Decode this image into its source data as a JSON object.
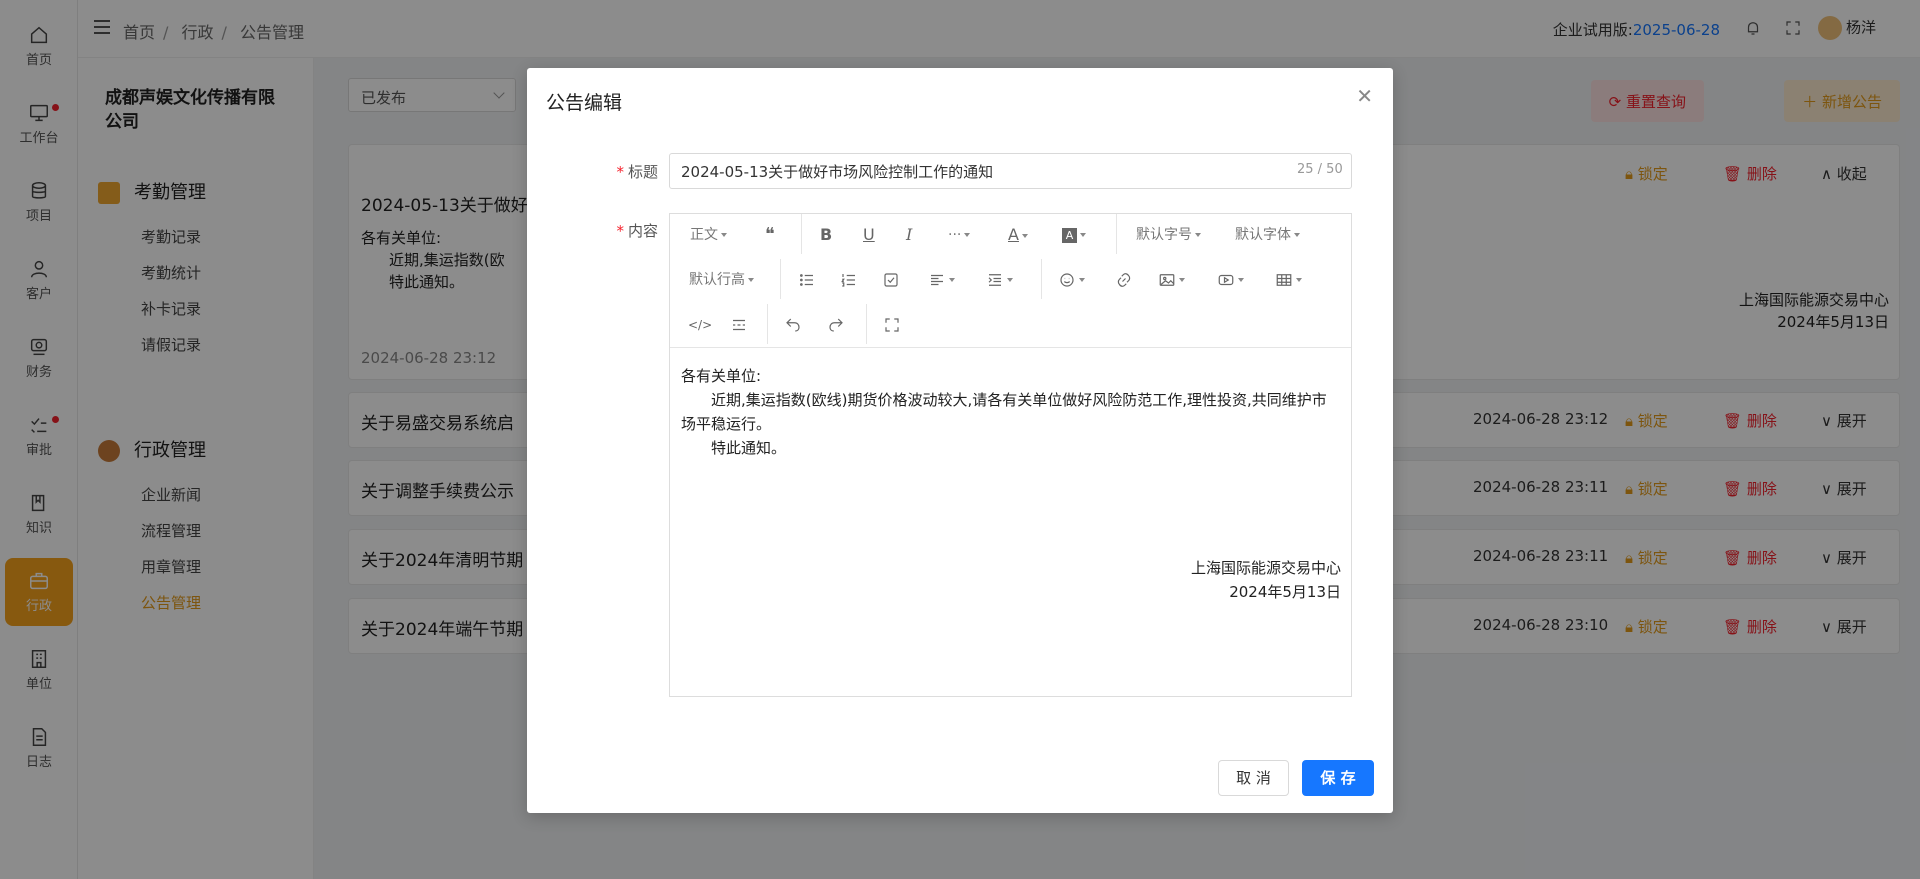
{
  "rail": {
    "items": [
      {
        "label": "首页",
        "icon": "home-icon"
      },
      {
        "label": "工作台",
        "icon": "monitor-icon"
      },
      {
        "label": "项目",
        "icon": "database-icon"
      },
      {
        "label": "客户",
        "icon": "user-icon"
      },
      {
        "label": "财务",
        "icon": "finance-icon"
      },
      {
        "label": "审批",
        "icon": "approval-icon"
      },
      {
        "label": "知识",
        "icon": "book-icon"
      },
      {
        "label": "行政",
        "icon": "briefcase-icon"
      },
      {
        "label": "单位",
        "icon": "building-icon"
      },
      {
        "label": "日志",
        "icon": "log-icon"
      }
    ],
    "active_color": "#f6a21d"
  },
  "topbar": {
    "breadcrumb": [
      "首页",
      "行政",
      "公告管理"
    ],
    "separator": "/",
    "trial_label": "企业试用版:",
    "trial_date": "2025-06-28",
    "user_name": "杨洋"
  },
  "sidenav": {
    "company": "成都声娱文化传播有限公司",
    "section1": {
      "title": "考勤管理",
      "items": [
        "考勤记录",
        "考勤统计",
        "补卡记录",
        "请假记录"
      ]
    },
    "section2": {
      "title": "行政管理",
      "items": [
        "企业新闻",
        "流程管理",
        "用章管理",
        "公告管理"
      ]
    }
  },
  "main": {
    "filter_value": "已发布",
    "reset_label": "重置查询",
    "add_label": "新增公告",
    "lock_label": "锁定",
    "delete_label": "删除",
    "collapse_label": "收起",
    "expand_label": "展开",
    "expanded": {
      "title": "2024-05-13关于做好",
      "body_l1": "各有关单位:",
      "body_l2": "近期,集运指数(欧",
      "body_l3": "特此通知。",
      "sign_org": "上海国际能源交易中心",
      "sign_date": "2024年5月13日",
      "time": "2024-06-28 23:12"
    },
    "rows": [
      {
        "title": "关于易盛交易系统启",
        "time": "2024-06-28 23:12"
      },
      {
        "title": "关于调整手续费公示",
        "time": "2024-06-28 23:11"
      },
      {
        "title": "关于2024年清明节期",
        "time": "2024-06-28 23:11"
      },
      {
        "title": "关于2024年端午节期",
        "time": "2024-06-28 23:10"
      }
    ]
  },
  "modal": {
    "title": "公告编辑",
    "title_label": "标题",
    "content_label": "内容",
    "title_value": "2024-05-13关于做好市场风险控制工作的通知",
    "counter": "25 / 50",
    "toolbar": {
      "paragraph": "正文",
      "font_size": "默认字号",
      "font_family": "默认字体",
      "line_height": "默认行高",
      "more": "···"
    },
    "content": {
      "p1": "各有关单位:",
      "p2": "近期,集运指数(欧线)期货价格波动较大,请各有关单位做好风险防范工作,理性投资,共同维护市场平稳运行。",
      "p3": "特此通知。",
      "sign_org": "上海国际能源交易中心",
      "sign_date": "2024年5月13日"
    },
    "cancel_label": "取 消",
    "save_label": "保 存",
    "primary_color": "#1677ff"
  }
}
